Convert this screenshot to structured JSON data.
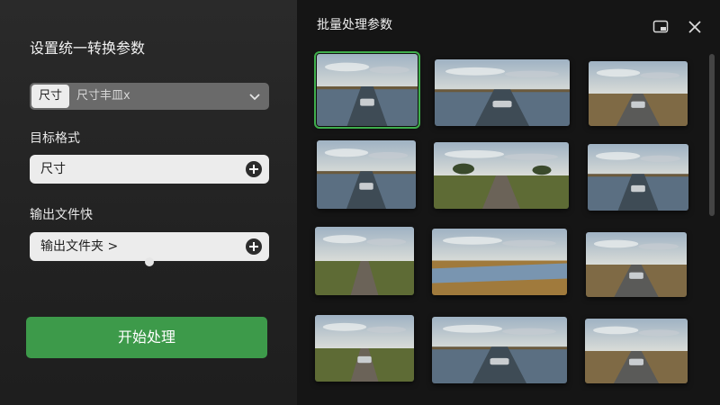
{
  "left_panel": {
    "title": "设置统一转换参数",
    "size_select": {
      "chip": "尺寸",
      "value": "尺寸丰皿x"
    },
    "target_format": {
      "label": "目标格式",
      "value": "尺寸"
    },
    "output_folder": {
      "label": "输出文件快",
      "value": "输出文件夹 >"
    },
    "start_button": "开始处理"
  },
  "right_panel": {
    "title": "批量处理参数",
    "selected_index": 0,
    "thumbnails": [
      {
        "scene": "water-road-car"
      },
      {
        "scene": "water-road-car"
      },
      {
        "scene": "dry-road-car"
      },
      {
        "scene": "water-road-car"
      },
      {
        "scene": "grass-road-tree"
      },
      {
        "scene": "water-road-car"
      },
      {
        "scene": "grass-road"
      },
      {
        "scene": "lake-grass"
      },
      {
        "scene": "dry-road-car"
      },
      {
        "scene": "grass-road-car"
      },
      {
        "scene": "water-road-car"
      },
      {
        "scene": "dry-road-car"
      }
    ]
  },
  "colors": {
    "accent_green": "#3d9a4a",
    "selection_outline": "#3fae4c"
  },
  "icons": [
    "chevron-down-icon",
    "plus-circle-icon",
    "window-icon",
    "close-icon"
  ]
}
